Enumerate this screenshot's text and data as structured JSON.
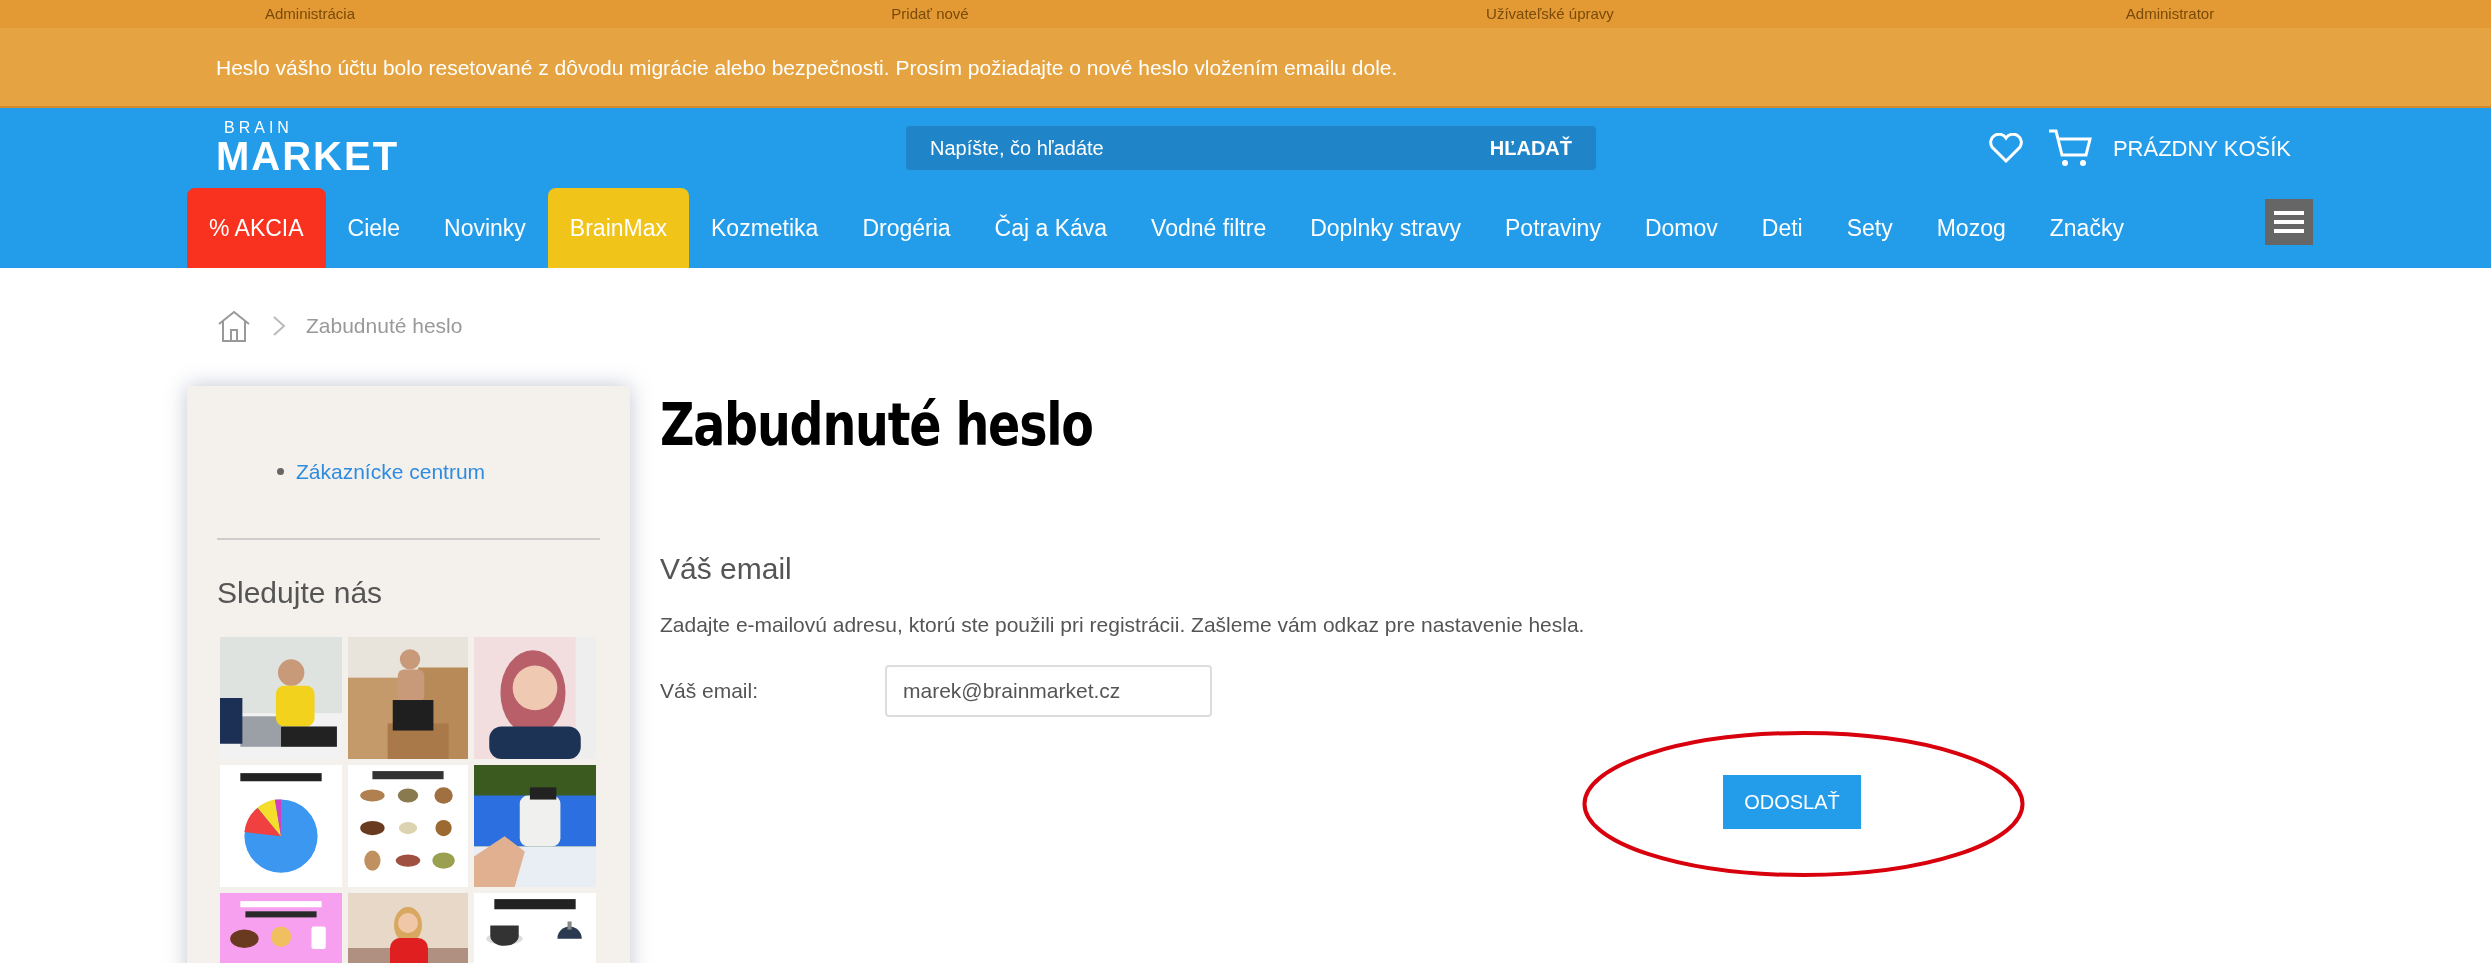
{
  "admin_bar": {
    "items": [
      "Administrácia",
      "Pridať nové",
      "Užívateľské úpravy",
      "Administrator"
    ]
  },
  "notice": {
    "text": "Heslo vášho účtu bolo resetované z dôvodu migrácie alebo bezpečnosti. Prosím požiadajte o nové heslo vložením emailu dole."
  },
  "header": {
    "logo_top": "BRAIN",
    "logo_bottom": "MARKET",
    "search_placeholder": "Napíšte, čo hľadáte",
    "search_button": "HĽADAŤ",
    "cart": "PRÁZDNY KOŠÍK"
  },
  "nav": [
    {
      "label": "% AKCIA",
      "kind": "sale"
    },
    {
      "label": "Ciele",
      "kind": "normal"
    },
    {
      "label": "Novinky",
      "kind": "normal"
    },
    {
      "label": "BrainMax",
      "kind": "highlight"
    },
    {
      "label": "Kozmetika",
      "kind": "normal"
    },
    {
      "label": "Drogéria",
      "kind": "normal"
    },
    {
      "label": "Čaj a Káva",
      "kind": "normal"
    },
    {
      "label": "Vodné filtre",
      "kind": "normal"
    },
    {
      "label": "Doplnky stravy",
      "kind": "normal"
    },
    {
      "label": "Potraviny",
      "kind": "normal"
    },
    {
      "label": "Domov",
      "kind": "normal"
    },
    {
      "label": "Deti",
      "kind": "normal"
    },
    {
      "label": "Sety",
      "kind": "normal"
    },
    {
      "label": "Mozog",
      "kind": "normal"
    },
    {
      "label": "Značky",
      "kind": "normal"
    }
  ],
  "breadcrumb": {
    "current": "Zabudnuté heslo"
  },
  "sidebar": {
    "links": [
      "Zákaznícke centrum"
    ],
    "follow_title": "Sledujte nás"
  },
  "main": {
    "title": "Zabudnuté heslo",
    "section_title": "Váš email",
    "description": "Zadajte e-mailovú adresu, ktorú ste použili pri registrácii. Zašleme vám odkaz pre nastavenie hesla.",
    "field_label": "Váš email:",
    "field_value": "marek@brainmarket.cz",
    "button": "ODOSLAŤ"
  }
}
